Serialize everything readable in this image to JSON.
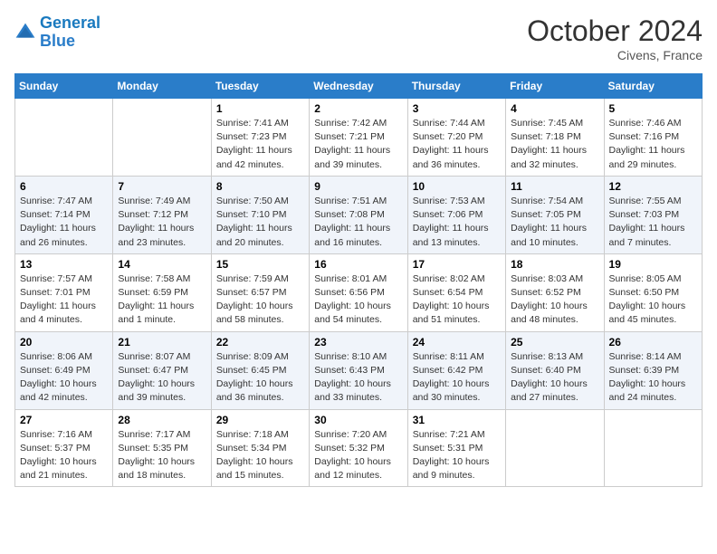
{
  "header": {
    "logo_line1": "General",
    "logo_line2": "Blue",
    "month": "October 2024",
    "location": "Civens, France"
  },
  "days_of_week": [
    "Sunday",
    "Monday",
    "Tuesday",
    "Wednesday",
    "Thursday",
    "Friday",
    "Saturday"
  ],
  "weeks": [
    [
      {
        "day": "",
        "info": ""
      },
      {
        "day": "",
        "info": ""
      },
      {
        "day": "1",
        "info": "Sunrise: 7:41 AM\nSunset: 7:23 PM\nDaylight: 11 hours and 42 minutes."
      },
      {
        "day": "2",
        "info": "Sunrise: 7:42 AM\nSunset: 7:21 PM\nDaylight: 11 hours and 39 minutes."
      },
      {
        "day": "3",
        "info": "Sunrise: 7:44 AM\nSunset: 7:20 PM\nDaylight: 11 hours and 36 minutes."
      },
      {
        "day": "4",
        "info": "Sunrise: 7:45 AM\nSunset: 7:18 PM\nDaylight: 11 hours and 32 minutes."
      },
      {
        "day": "5",
        "info": "Sunrise: 7:46 AM\nSunset: 7:16 PM\nDaylight: 11 hours and 29 minutes."
      }
    ],
    [
      {
        "day": "6",
        "info": "Sunrise: 7:47 AM\nSunset: 7:14 PM\nDaylight: 11 hours and 26 minutes."
      },
      {
        "day": "7",
        "info": "Sunrise: 7:49 AM\nSunset: 7:12 PM\nDaylight: 11 hours and 23 minutes."
      },
      {
        "day": "8",
        "info": "Sunrise: 7:50 AM\nSunset: 7:10 PM\nDaylight: 11 hours and 20 minutes."
      },
      {
        "day": "9",
        "info": "Sunrise: 7:51 AM\nSunset: 7:08 PM\nDaylight: 11 hours and 16 minutes."
      },
      {
        "day": "10",
        "info": "Sunrise: 7:53 AM\nSunset: 7:06 PM\nDaylight: 11 hours and 13 minutes."
      },
      {
        "day": "11",
        "info": "Sunrise: 7:54 AM\nSunset: 7:05 PM\nDaylight: 11 hours and 10 minutes."
      },
      {
        "day": "12",
        "info": "Sunrise: 7:55 AM\nSunset: 7:03 PM\nDaylight: 11 hours and 7 minutes."
      }
    ],
    [
      {
        "day": "13",
        "info": "Sunrise: 7:57 AM\nSunset: 7:01 PM\nDaylight: 11 hours and 4 minutes."
      },
      {
        "day": "14",
        "info": "Sunrise: 7:58 AM\nSunset: 6:59 PM\nDaylight: 11 hours and 1 minute."
      },
      {
        "day": "15",
        "info": "Sunrise: 7:59 AM\nSunset: 6:57 PM\nDaylight: 10 hours and 58 minutes."
      },
      {
        "day": "16",
        "info": "Sunrise: 8:01 AM\nSunset: 6:56 PM\nDaylight: 10 hours and 54 minutes."
      },
      {
        "day": "17",
        "info": "Sunrise: 8:02 AM\nSunset: 6:54 PM\nDaylight: 10 hours and 51 minutes."
      },
      {
        "day": "18",
        "info": "Sunrise: 8:03 AM\nSunset: 6:52 PM\nDaylight: 10 hours and 48 minutes."
      },
      {
        "day": "19",
        "info": "Sunrise: 8:05 AM\nSunset: 6:50 PM\nDaylight: 10 hours and 45 minutes."
      }
    ],
    [
      {
        "day": "20",
        "info": "Sunrise: 8:06 AM\nSunset: 6:49 PM\nDaylight: 10 hours and 42 minutes."
      },
      {
        "day": "21",
        "info": "Sunrise: 8:07 AM\nSunset: 6:47 PM\nDaylight: 10 hours and 39 minutes."
      },
      {
        "day": "22",
        "info": "Sunrise: 8:09 AM\nSunset: 6:45 PM\nDaylight: 10 hours and 36 minutes."
      },
      {
        "day": "23",
        "info": "Sunrise: 8:10 AM\nSunset: 6:43 PM\nDaylight: 10 hours and 33 minutes."
      },
      {
        "day": "24",
        "info": "Sunrise: 8:11 AM\nSunset: 6:42 PM\nDaylight: 10 hours and 30 minutes."
      },
      {
        "day": "25",
        "info": "Sunrise: 8:13 AM\nSunset: 6:40 PM\nDaylight: 10 hours and 27 minutes."
      },
      {
        "day": "26",
        "info": "Sunrise: 8:14 AM\nSunset: 6:39 PM\nDaylight: 10 hours and 24 minutes."
      }
    ],
    [
      {
        "day": "27",
        "info": "Sunrise: 7:16 AM\nSunset: 5:37 PM\nDaylight: 10 hours and 21 minutes."
      },
      {
        "day": "28",
        "info": "Sunrise: 7:17 AM\nSunset: 5:35 PM\nDaylight: 10 hours and 18 minutes."
      },
      {
        "day": "29",
        "info": "Sunrise: 7:18 AM\nSunset: 5:34 PM\nDaylight: 10 hours and 15 minutes."
      },
      {
        "day": "30",
        "info": "Sunrise: 7:20 AM\nSunset: 5:32 PM\nDaylight: 10 hours and 12 minutes."
      },
      {
        "day": "31",
        "info": "Sunrise: 7:21 AM\nSunset: 5:31 PM\nDaylight: 10 hours and 9 minutes."
      },
      {
        "day": "",
        "info": ""
      },
      {
        "day": "",
        "info": ""
      }
    ]
  ]
}
